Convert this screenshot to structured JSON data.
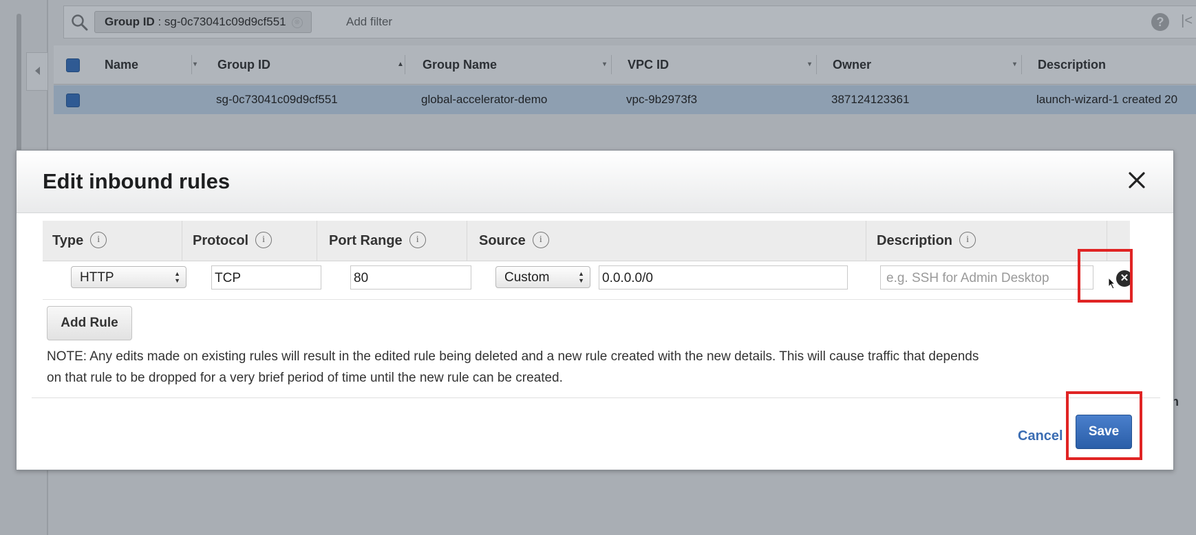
{
  "filter_bar": {
    "chip_key": "Group ID",
    "chip_value": "sg-0c73041c09d9cf551",
    "chip_close": "⊗",
    "add_filter": "Add filter",
    "help": "?",
    "first_page": "|<"
  },
  "table": {
    "headers": [
      "Name",
      "Group ID",
      "Group Name",
      "VPC ID",
      "Owner",
      "Description"
    ],
    "sorted_column": "Group ID",
    "rows": [
      {
        "name": "",
        "group_id": "sg-0c73041c09d9cf551",
        "group_name": "global-accelerator-demo",
        "vpc_id": "vpc-9b2973f3",
        "owner": "387124123361",
        "description": "launch-wizard-1 created 20"
      }
    ],
    "right_partial_label": "n"
  },
  "modal": {
    "title": "Edit inbound rules",
    "columns": [
      {
        "label": "Type",
        "info": "i"
      },
      {
        "label": "Protocol",
        "info": "i"
      },
      {
        "label": "Port Range",
        "info": "i"
      },
      {
        "label": "Source",
        "info": "i"
      },
      {
        "label": "Description",
        "info": "i"
      }
    ],
    "rule": {
      "type": "HTTP",
      "protocol": "TCP",
      "port_range": "80",
      "source_type": "Custom",
      "source_cidr": "0.0.0.0/0",
      "description_placeholder": "e.g. SSH for Admin Desktop",
      "delete_glyph": "✕"
    },
    "add_rule_label": "Add Rule",
    "note_line1": "NOTE: Any edits made on existing rules will result in the edited rule being deleted and a new rule created with the new details. This will cause traffic that depends",
    "note_line2": "on that rule to be dropped for a very brief period of time until the new rule can be created.",
    "cancel_label": "Cancel",
    "save_label": "Save"
  },
  "colors": {
    "highlight": "#e02424",
    "primary_button": "#2a5ea8",
    "link": "#3b6db3"
  }
}
